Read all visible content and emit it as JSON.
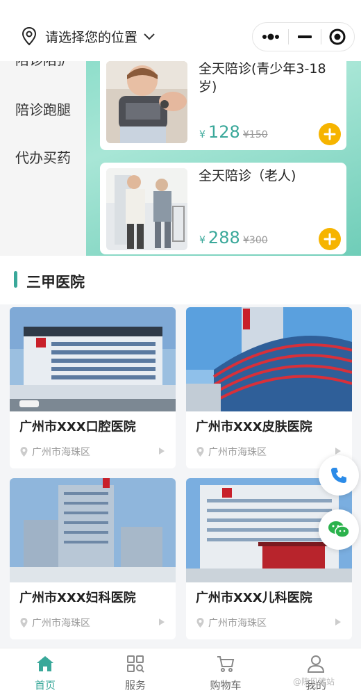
{
  "header": {
    "location_placeholder": "请选择您的位置"
  },
  "colors": {
    "accent": "#3aa89a",
    "add_button": "#f6b400"
  },
  "sidebar": {
    "items": [
      {
        "label": "陪诊陪护"
      },
      {
        "label": "陪诊跑腿"
      },
      {
        "label": "代办买药"
      }
    ]
  },
  "services": [
    {
      "title": "全天陪诊(青少年3-18岁)",
      "price": "128",
      "old_price": "¥150",
      "currency": "¥"
    },
    {
      "title": "全天陪诊（老人)",
      "price": "288",
      "old_price": "¥300",
      "currency": "¥"
    }
  ],
  "hospitals": {
    "section_title": "三甲医院",
    "items": [
      {
        "name": "广州市XXX口腔医院",
        "district": "广州市海珠区"
      },
      {
        "name": "广州市XXX皮肤医院",
        "district": "广州市海珠区"
      },
      {
        "name": "广州市XXX妇科医院",
        "district": "广州市海珠区"
      },
      {
        "name": "广州市XXX儿科医院",
        "district": "广州市海珠区"
      }
    ]
  },
  "float_buttons": [
    {
      "icon": "phone-icon"
    },
    {
      "icon": "wechat-icon"
    }
  ],
  "tabbar": {
    "tabs": [
      {
        "label": "首页",
        "icon": "home-icon",
        "active": true
      },
      {
        "label": "服务",
        "icon": "grid-search-icon",
        "active": false
      },
      {
        "label": "购物车",
        "icon": "cart-icon",
        "active": false
      },
      {
        "label": "我的",
        "icon": "user-icon",
        "active": false
      }
    ]
  },
  "watermark": "@陈贝建站"
}
